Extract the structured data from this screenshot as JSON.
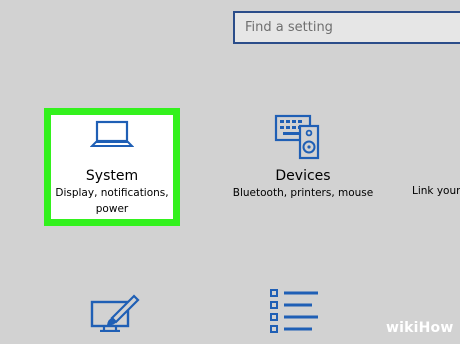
{
  "search": {
    "placeholder": "Find a setting"
  },
  "tiles": [
    {
      "icon": "laptop-icon",
      "title": "System",
      "subtitle_line1": "Display, notifications,",
      "subtitle_line2": "power",
      "highlighted": true,
      "highlight_color": "#33f11d"
    },
    {
      "icon": "keyboard-speaker-icon",
      "title": "Devices",
      "subtitle": "Bluetooth, printers, mouse"
    },
    {
      "subtitle_partial": "Link your"
    }
  ],
  "lower_icons": [
    "personalization-brush-icon",
    "apps-list-icon"
  ],
  "watermark": {
    "text": "wikiHow",
    "prefix": "wiki",
    "suffix": "How"
  },
  "colors": {
    "background": "#d2d2d2",
    "accent": "#1f5fb5",
    "search_border": "#2b4d8a",
    "highlight": "#33f11d"
  }
}
